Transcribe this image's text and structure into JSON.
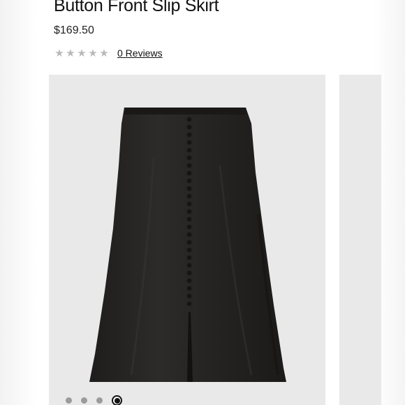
{
  "product": {
    "title": "Button Front Slip Skirt",
    "price": "$169.50",
    "rating": {
      "value": 0,
      "max": 5,
      "star_glyph": "★",
      "star_color": "#b9b9b9"
    },
    "reviews_label": "0 Reviews"
  },
  "gallery": {
    "image_icon": "black-slip-skirt-image",
    "dots_count": 4,
    "active_index": 3,
    "background": "#e9e9e9",
    "garment_color": "#2a2827"
  }
}
